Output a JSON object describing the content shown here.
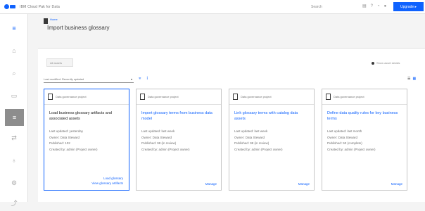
{
  "topbar": {
    "brand": "IBM Cloud Pak for Data",
    "search_label": "Search",
    "icons": [
      "catalog-icon",
      "help-icon",
      "notification-icon",
      "avatar-icon"
    ],
    "upgrade_label": "Upgrade ▸"
  },
  "sidebar": {
    "items": [
      {
        "icon": "menu-icon",
        "glyph": "≡"
      },
      {
        "icon": "home-icon",
        "glyph": "⌂"
      },
      {
        "icon": "search-icon",
        "glyph": "⌕"
      },
      {
        "icon": "comment-icon",
        "glyph": "▭"
      },
      {
        "icon": "document-icon",
        "glyph": "≡"
      },
      {
        "icon": "flow-icon",
        "glyph": "⇄"
      },
      {
        "icon": "key-icon",
        "glyph": "♁"
      },
      {
        "icon": "settings-icon",
        "glyph": "⚙"
      },
      {
        "icon": "share-icon",
        "glyph": "⤴"
      }
    ]
  },
  "breadcrumb": {
    "label": "Home"
  },
  "page": {
    "title": "Import business glossary"
  },
  "tabs": {
    "active": "All assets"
  },
  "view_toggle": {
    "label": "Show asset details"
  },
  "filter": {
    "label": "Last modified: Recently updated"
  },
  "filter_icons": [
    "filter-icon",
    "info-icon"
  ],
  "view_icons": [
    "list-icon",
    "grid-icon"
  ],
  "cards": [
    {
      "head": "Data governance project",
      "title": "Load business glossary artifacts and associated assets",
      "lines": [
        "Last updated: yesterday",
        "Owner: Data Steward",
        "Published: 102",
        "Created by: admin (Project owner)"
      ],
      "links": [
        "Load glossary",
        "View glossary artifacts"
      ]
    },
    {
      "head": "Data governance project",
      "title": "Import glossary terms from business data model",
      "lines": [
        "Last updated: last week",
        "Owner: Data Steward",
        "Published: 98 (in review)",
        "Created by: admin (Project owner)"
      ],
      "manage": "Manage"
    },
    {
      "head": "Data governance project",
      "title": "Link glossary terms with catalog data assets",
      "lines": [
        "Last updated: last week",
        "Owner: Data Steward",
        "Published: 98 (in review)",
        "Created by: admin (Project owner)"
      ],
      "manage": "Manage"
    },
    {
      "head": "Data governance project",
      "title": "Define data quality rules for key business terms",
      "lines": [
        "Last updated: last month",
        "Owner: Data Steward",
        "Published: 50 (complete)",
        "Created by: admin (Project owner)"
      ],
      "manage": "Manage"
    }
  ]
}
